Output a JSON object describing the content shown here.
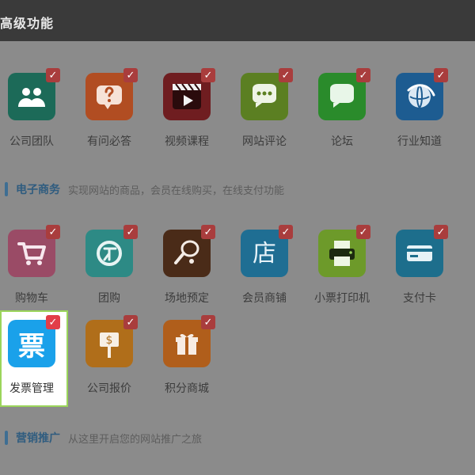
{
  "window": {
    "title": "高级功能"
  },
  "sections": [
    {
      "name": "电子商务",
      "desc": "实现网站的商品，会员在线购买，在线支付功能"
    },
    {
      "name": "营销推广",
      "desc": "从这里开启您的网站推广之旅"
    }
  ],
  "tiles_row1": [
    {
      "label": "公司团队",
      "icon": "team-icon",
      "color": "#1c6a58"
    },
    {
      "label": "有问必答",
      "icon": "question-icon",
      "color": "#b14d22"
    },
    {
      "label": "视频课程",
      "icon": "video-icon",
      "color": "#6f1d20"
    },
    {
      "label": "网站评论",
      "icon": "comment-icon",
      "color": "#5b7f22"
    },
    {
      "label": "论坛",
      "icon": "forum-icon",
      "color": "#2a8b2b"
    },
    {
      "label": "行业知道",
      "icon": "globe-icon",
      "color": "#1d5c91"
    }
  ],
  "tiles_row2": [
    {
      "label": "购物车",
      "icon": "cart-icon",
      "color": "#9a4b66"
    },
    {
      "label": "团购",
      "icon": "group-buy-icon",
      "color": "#2d8a85"
    },
    {
      "label": "场地预定",
      "icon": "racket-icon",
      "color": "#4a2b18"
    },
    {
      "label": "会员商铺",
      "icon": "shop-icon",
      "color": "#1f6e93"
    },
    {
      "label": "小票打印机",
      "icon": "printer-icon",
      "color": "#6d9a2a"
    },
    {
      "label": "支付卡",
      "icon": "card-icon",
      "color": "#1d6e8c"
    }
  ],
  "tiles_row3": [
    {
      "label": "发票管理",
      "icon": "invoice-icon",
      "color": "#1aa1ea",
      "glyph": "票"
    },
    {
      "label": "公司报价",
      "icon": "price-sign-icon",
      "color": "#b06e1a"
    },
    {
      "label": "积分商城",
      "icon": "gift-icon",
      "color": "#b05e1b"
    }
  ]
}
